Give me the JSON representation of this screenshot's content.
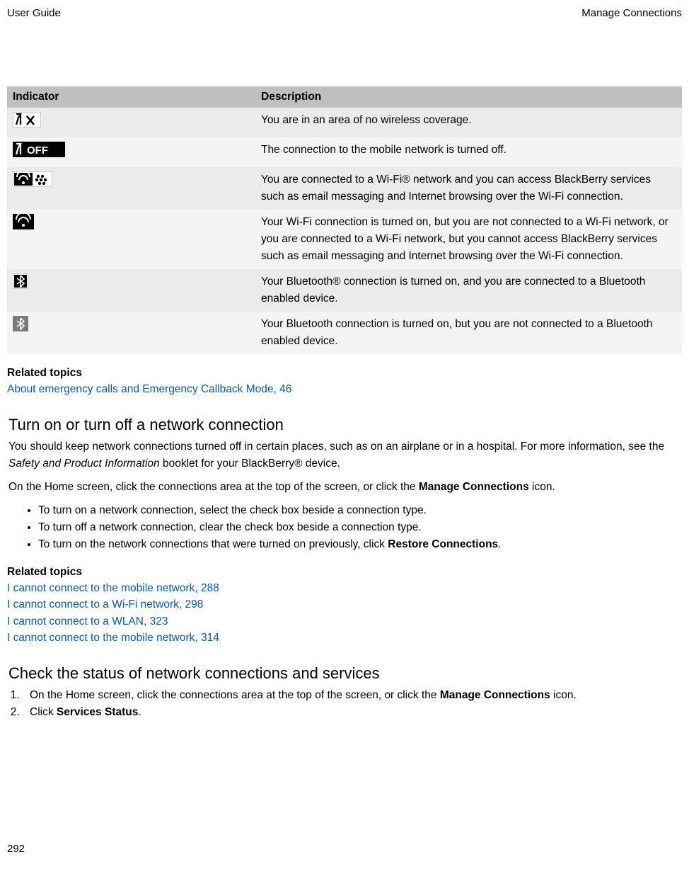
{
  "header": {
    "left": "User Guide",
    "right": "Manage Connections"
  },
  "table": {
    "header": {
      "indicator": "Indicator",
      "description": "Description"
    },
    "rows": [
      {
        "icon": "no-coverage",
        "desc": "You are in an area of no wireless coverage."
      },
      {
        "icon": "off",
        "desc": "The connection to the mobile network is turned off."
      },
      {
        "icon": "wifi-bb",
        "desc": "You are connected to a Wi-Fi® network and you can access BlackBerry services such as email messaging and Internet browsing over the Wi-Fi connection."
      },
      {
        "icon": "wifi",
        "desc": "Your Wi-Fi connection is turned on, but you are not connected to a Wi-Fi network, or you are connected to a Wi-Fi network, but you cannot access BlackBerry services such as email messaging and Internet browsing over the Wi-Fi connection."
      },
      {
        "icon": "bt-connected",
        "desc": "Your Bluetooth® connection is turned on, and you are connected to a Bluetooth enabled device."
      },
      {
        "icon": "bt",
        "desc": "Your Bluetooth connection is turned on, but you are not connected to a Bluetooth enabled device."
      }
    ]
  },
  "related1": {
    "heading": "Related topics",
    "links": [
      "About emergency calls and Emergency Callback Mode, 46"
    ]
  },
  "section1": {
    "title": "Turn on or turn off a network connection",
    "para1a": "You should keep network connections turned off in certain places, such as on an airplane or in a hospital. For more information, see the ",
    "para1b_italic": "Safety and Product Information",
    "para1c": " booklet for your BlackBerry® device.",
    "para2a": "On the Home screen, click the connections area at the top of the screen, or click the ",
    "para2b_bold": "Manage Connections",
    "para2c": " icon.",
    "bullets": [
      "To turn on a network connection, select the check box beside a connection type.",
      "To turn off a network connection, clear the check box beside a connection type."
    ],
    "bullet3a": "To turn on the network connections that were turned on previously, click ",
    "bullet3b_bold": "Restore Connections",
    "bullet3c": "."
  },
  "related2": {
    "heading": "Related topics",
    "links": [
      "I cannot connect to the mobile network, 288",
      "I cannot connect to a Wi-Fi network, 298",
      "I cannot connect to a WLAN, 323",
      "I cannot connect to the mobile network, 314"
    ]
  },
  "section2": {
    "title": "Check the status of network connections and services",
    "step1a": "On the Home screen, click the connections area at the top of the screen, or click the ",
    "step1b_bold": "Manage Connections",
    "step1c": " icon.",
    "step2a": "Click ",
    "step2b_bold": "Services Status",
    "step2c": "."
  },
  "pageNumber": "292"
}
